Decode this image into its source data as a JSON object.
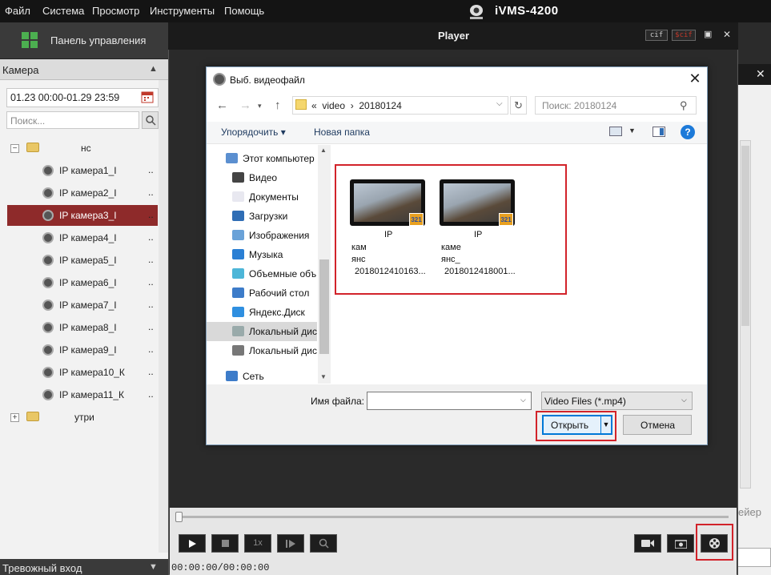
{
  "menu": [
    "Файл",
    "Система",
    "Просмотр",
    "Инструменты",
    "Помощь"
  ],
  "app_title": "iVMS-4200",
  "control_panel": "Панель управления",
  "left": {
    "header": "Камера",
    "date_range": "01.23 00:00-01.29 23:59",
    "search_placeholder": "Поиск...",
    "group1": "нс",
    "cameras": [
      "IP камера1_I",
      "IP камера2_I",
      "IP камера3_I",
      "IP камера4_I",
      "IP камера5_I",
      "IP камера6_I",
      "IP камера7_I",
      "IP камера8_I",
      "IP камера9_I",
      "IP камера10_К",
      "IP камера11_К"
    ],
    "dots": "..",
    "group2": "утри",
    "alarm": "Тревожный вход"
  },
  "player": {
    "title": "Player",
    "btn_cif": "cif",
    "btn_scif": "$cif",
    "time": "00:00:00/00:00:00",
    "speed": "1x"
  },
  "dialog": {
    "title": "Выб. видеофайл",
    "address": "«  video  ›  20180124",
    "search_placeholder": "Поиск: 20180124",
    "organize": "Упорядочить ▾",
    "new_folder": "Новая папка",
    "nav": [
      "Этот компьютер",
      "Видео",
      "Документы",
      "Загрузки",
      "Изображения",
      "Музыка",
      "Объемные объ",
      "Рабочий стол",
      "Яндекс.Диск",
      "Локальный дис",
      "Локальный дис",
      "Сеть"
    ],
    "files": [
      {
        "l1": "IP",
        "l2": "кам",
        "l3": "янс",
        "l4": "2018012410163..."
      },
      {
        "l1": "IP",
        "l2": "каме",
        "l3": "янс_",
        "l4": "2018012418001..."
      }
    ],
    "file_name_label": "Имя файла:",
    "file_name_value": "",
    "file_type": "Video Files (*.mp4)",
    "open": "Открыть",
    "cancel": "Отмена"
  },
  "right_bg_text": "ейер",
  "colors": {
    "selection": "#8e2a2a",
    "highlight_box": "#d2232a",
    "accent": "#0078d7"
  }
}
